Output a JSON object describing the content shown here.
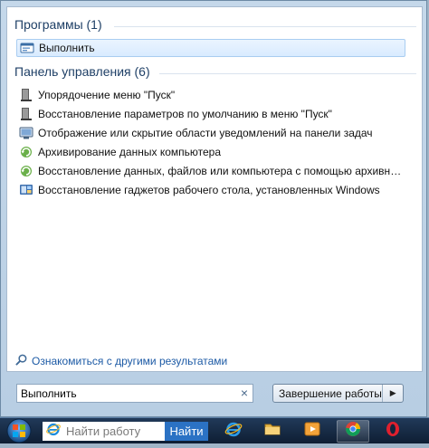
{
  "groups": [
    {
      "title": "Программы (1)",
      "items": [
        {
          "label": "Выполнить",
          "icon": "run-icon",
          "selected": true
        }
      ]
    },
    {
      "title": "Панель управления (6)",
      "items": [
        {
          "label": "Упорядочение меню \"Пуск\"",
          "icon": "start-menu-icon"
        },
        {
          "label": "Восстановление параметров по умолчанию в меню \"Пуск\"",
          "icon": "start-menu-icon"
        },
        {
          "label": "Отображение или скрытие области уведомлений на панели задач",
          "icon": "notification-area-icon"
        },
        {
          "label": "Архивирование данных компьютера",
          "icon": "backup-icon"
        },
        {
          "label": "Восстановление данных, файлов или компьютера с помощью архивных ко...",
          "icon": "backup-icon"
        },
        {
          "label": "Восстановление гаджетов рабочего стола, установленных Windows",
          "icon": "gadgets-icon"
        }
      ]
    }
  ],
  "see_more": "Ознакомиться с другими результатами",
  "search": {
    "value": "Выполнить"
  },
  "shutdown": {
    "label": "Завершение работы"
  },
  "taskbar": {
    "search_placeholder": "Найти работу",
    "find_button": "Найти",
    "apps": [
      {
        "icon": "internet-explorer-icon",
        "active": false
      },
      {
        "icon": "folder-icon",
        "active": false
      },
      {
        "icon": "media-player-icon",
        "active": false
      },
      {
        "icon": "chrome-icon",
        "active": true
      },
      {
        "icon": "opera-icon",
        "active": false
      }
    ]
  },
  "colors": {
    "group_title": "#1e3f66",
    "link": "#1c5aa5",
    "taskbar": "#13253d",
    "find_button": "#2b72c4"
  }
}
